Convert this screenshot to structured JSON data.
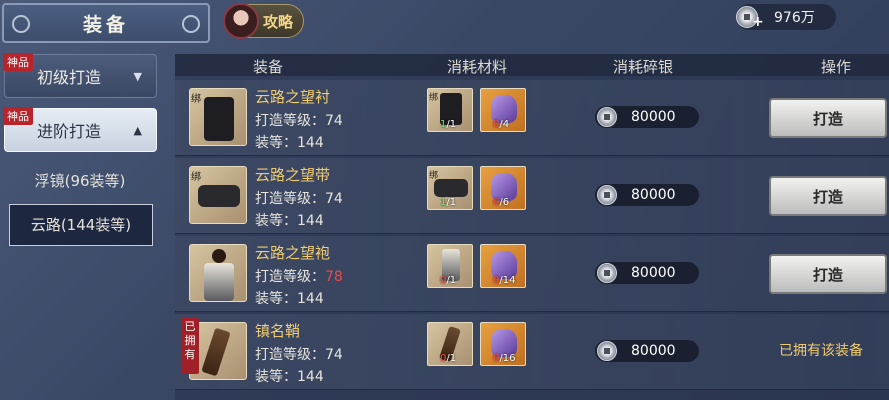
{
  "header": {
    "title": "装备",
    "guide_label": "攻略",
    "currency_amount": "976万"
  },
  "menu": {
    "categories": [
      {
        "tag": "神品",
        "label": "初级打造",
        "arrow": "▼"
      },
      {
        "tag": "神品",
        "label": "进阶打造",
        "arrow": "▲"
      }
    ],
    "subitems": [
      "浮镜(96装等)",
      "云路(144装等)"
    ]
  },
  "table": {
    "headers": [
      "装备",
      "消耗材料",
      "消耗碎银",
      "操作"
    ],
    "rows": [
      {
        "bind": "绑",
        "name": "云路之望衬",
        "level_label": "打造等级：",
        "level": "74",
        "eq_label": "装等：",
        "eq": "144",
        "mat1_bind": "绑",
        "mat1_have": "1",
        "mat1_need": "/1",
        "mat2_have": "0",
        "mat2_need": "/4",
        "cost": "80000",
        "action": "打造"
      },
      {
        "bind": "绑",
        "name": "云路之望带",
        "level_label": "打造等级：",
        "level": "74",
        "eq_label": "装等：",
        "eq": "144",
        "mat1_bind": "绑",
        "mat1_have": "1",
        "mat1_need": "/1",
        "mat2_have": "0",
        "mat2_need": "/6",
        "cost": "80000",
        "action": "打造"
      },
      {
        "bind": "",
        "name": "云路之望袍",
        "level_label": "打造等级：",
        "level": "78",
        "eq_label": "装等：",
        "eq": "144",
        "mat1_bind": "",
        "mat1_have": "0",
        "mat1_need": "/1",
        "mat2_have": "0",
        "mat2_need": "/14",
        "cost": "80000",
        "action": "打造"
      },
      {
        "owned_tag": "已拥有",
        "name": "镇名鞘",
        "level_label": "打造等级：",
        "level": "74",
        "eq_label": "装等：",
        "eq": "144",
        "mat1_have": "0",
        "mat1_need": "/1",
        "mat2_have": "0",
        "mat2_need": "/16",
        "cost": "80000",
        "action_text": "已拥有该装备"
      }
    ]
  }
}
